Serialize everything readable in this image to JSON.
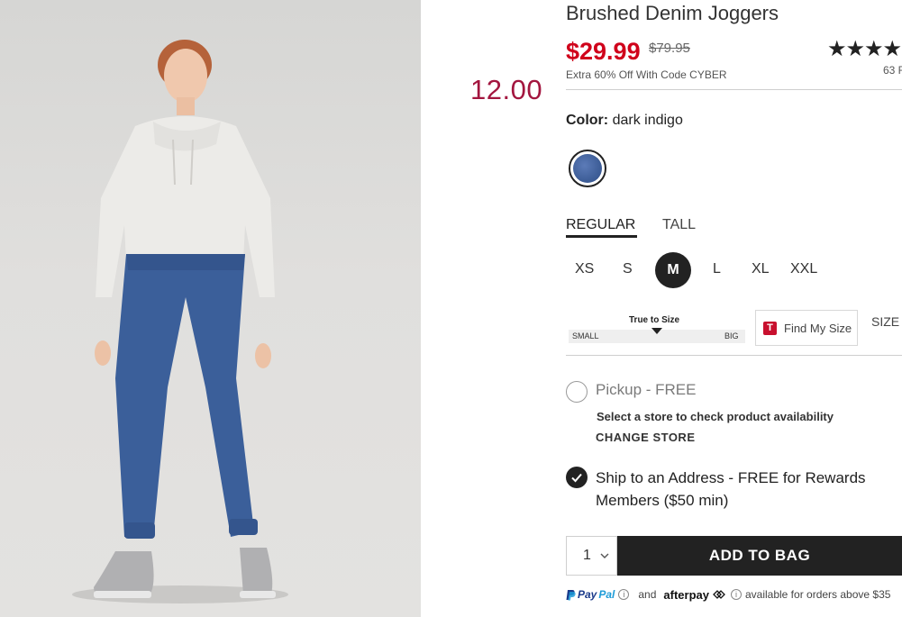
{
  "promo_price": "12.00",
  "product": {
    "title": "Brushed Denim Joggers",
    "price_now": "$29.99",
    "price_was": "$79.95",
    "promo_code": "Extra 60% Off With Code CYBER",
    "stars": "★★★★",
    "review_count": "63 R"
  },
  "color": {
    "label": "Color:",
    "value": "dark indigo",
    "swatch_color": "#3f5f99"
  },
  "fit_tabs": [
    {
      "label": "REGULAR",
      "active": true
    },
    {
      "label": "TALL",
      "active": false
    }
  ],
  "sizes": {
    "options": [
      "XS",
      "S",
      "M",
      "L",
      "XL",
      "XXL"
    ],
    "selected": "M"
  },
  "true_to_size": {
    "label": "True to Size",
    "small": "SMALL",
    "big": "BIG",
    "level": 0.5
  },
  "find_my_size": {
    "icon_letter": "T",
    "label": "Find My Size"
  },
  "size_chart": "SIZE",
  "fulfillment": {
    "pickup_label": "Pickup - FREE",
    "store_note": "Select a store to check product availability",
    "change_store": "CHANGE STORE",
    "ship_label": "Ship to an Address - FREE for Rewards Members ($50 min)",
    "selected": "ship"
  },
  "cart": {
    "quantity": "1",
    "add_label": "ADD TO BAG"
  },
  "payment": {
    "paypal_a": "Pay",
    "paypal_b": "Pal",
    "and": "and",
    "afterpay": "afterpay",
    "afterpay_note": "available for orders above $35"
  },
  "colors": {
    "sale_red": "#d0021b",
    "promo_magenta": "#a3163f",
    "button_black": "#222222"
  }
}
